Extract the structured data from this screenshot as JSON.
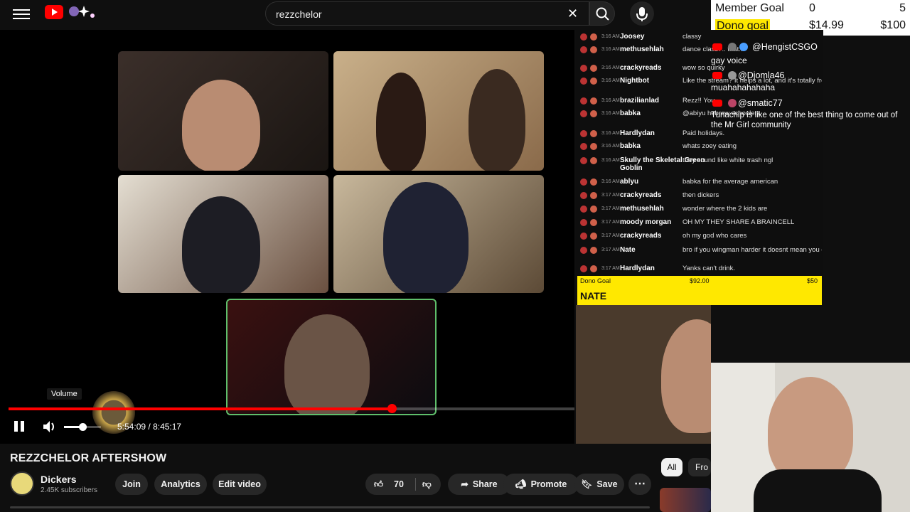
{
  "search": {
    "value": "rezzchelor"
  },
  "overlay_goals": {
    "member": {
      "label": "Member Goal",
      "current": "0",
      "target": "5"
    },
    "dono": {
      "label": "Dono goal",
      "current": "$14.99",
      "target": "$100"
    }
  },
  "chat": [
    {
      "time": "3:16 AM",
      "user": "Joosey",
      "msg": "classy"
    },
    {
      "time": "3:16 AM",
      "user": "methusehlah",
      "msg": "dance class?.. that..."
    },
    {
      "time": "3:16 AM",
      "user": "crackyreads",
      "msg": "wow so quirky"
    },
    {
      "time": "3:16 AM",
      "user": "Nightbot",
      "msg": "Like the stream? It helps a lot, and it's totally free"
    },
    {
      "time": "3:16 AM",
      "user": "brazilianlad",
      "msg": "Rezz!! You"
    },
    {
      "time": "3:16 AM",
      "user": "babka",
      "msg": "@abiyu hebrew schoolers"
    },
    {
      "time": "3:16 AM",
      "user": "Hardlydan",
      "msg": "Paid holidays."
    },
    {
      "time": "3:16 AM",
      "user": "babka",
      "msg": "whats zoey eating"
    },
    {
      "time": "3:16 AM",
      "user": "Skully the Skeletal Green Goblin",
      "msg": "they sound like white trash ngl"
    },
    {
      "time": "3:16 AM",
      "user": "ablyu",
      "msg": "babka for the average american"
    },
    {
      "time": "3:17 AM",
      "user": "crackyreads",
      "msg": "then dickers"
    },
    {
      "time": "3:17 AM",
      "user": "methusehlah",
      "msg": "wonder where the 2 kids are"
    },
    {
      "time": "3:17 AM",
      "user": "moody morgan",
      "msg": "OH MY THEY SHARE A BRAINCELL"
    },
    {
      "time": "3:17 AM",
      "user": "crackyreads",
      "msg": "oh my god who cares"
    },
    {
      "time": "3:17 AM",
      "user": "Nate",
      "msg": "bro if you wingman harder it doesnt mean you got in."
    },
    {
      "time": "3:17 AM",
      "user": "Hardlydan",
      "msg": "Yanks can't drink."
    }
  ],
  "inner_dono": {
    "label": "Dono Goal",
    "current": "$92.00",
    "target": "$50"
  },
  "nate_label": "NATE",
  "overlay_chat": [
    {
      "user": "@HengistCSGO",
      "msg": "gay voice"
    },
    {
      "user": "@Djomla46",
      "msg": "muahahahahaha"
    },
    {
      "user": "@smatic77",
      "msg": "Tunachip is like one of the best thing to come out of the Mr Girl community"
    }
  ],
  "player": {
    "volume_tooltip": "Volume",
    "time_current": "5:54:09",
    "time_separator": " / ",
    "time_total": "8:45:17",
    "progress": 0.6768,
    "volume": 0.5
  },
  "video": {
    "title": "REZZCHELOR AFTERSHOW",
    "channel": "Dickers",
    "subscribers": "2.45K subscribers"
  },
  "actions": {
    "join": "Join",
    "analytics": "Analytics",
    "edit": "Edit video",
    "likes": "70",
    "share": "Share",
    "promote": "Promote",
    "save": "Save",
    "more": "⋯"
  },
  "chips": {
    "all": "All",
    "from": "Fro"
  },
  "colors": {
    "accent": "#ff0000",
    "goal_yellow": "#ffe800",
    "bg": "#0f0f0f"
  }
}
